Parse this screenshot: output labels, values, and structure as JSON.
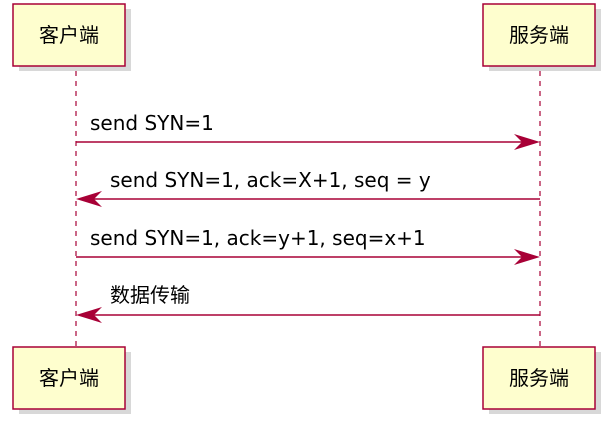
{
  "participants": [
    {
      "name": "客户端"
    },
    {
      "name": "服务端"
    }
  ],
  "messages": [
    {
      "text": "send SYN=1",
      "from": 0,
      "to": 1
    },
    {
      "text": "send SYN=1, ack=X+1, seq = y",
      "from": 1,
      "to": 0
    },
    {
      "text": "send SYN=1, ack=y+1, seq=x+1",
      "from": 0,
      "to": 1
    },
    {
      "text": "数据传输",
      "from": 1,
      "to": 0
    }
  ],
  "colors": {
    "box_fill": "#FEFECE",
    "line": "#A80036"
  }
}
